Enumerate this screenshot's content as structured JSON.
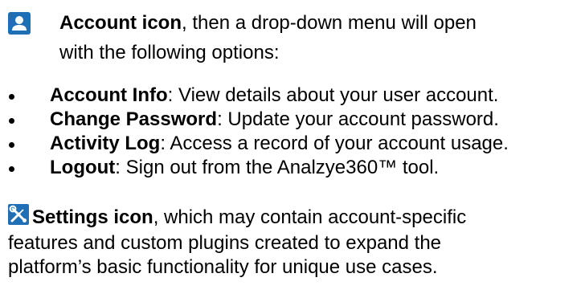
{
  "account_section": {
    "icon": "account-icon",
    "icon_color": "#1e6fb5",
    "title": "Account icon",
    "rest_line1": ", then a drop-down menu will open",
    "rest_line2": "with the following options:"
  },
  "options": [
    {
      "label": "Account Info",
      "desc": ": View details about your user account."
    },
    {
      "label": "Change Password",
      "desc": ": Update your account password."
    },
    {
      "label": "Activity Log",
      "desc": ": Access a record of your account usage."
    },
    {
      "label": "Logout",
      "desc": ": Sign out from the Analzye360™ tool."
    }
  ],
  "settings_section": {
    "icon": "settings-icon",
    "icon_color": "#1e6fb5",
    "title": "Settings icon",
    "rest_line1": ", which may contain account-specific",
    "line2": "features and custom plugins created to expand the",
    "line3": "platform’s basic functionality for unique use cases."
  }
}
